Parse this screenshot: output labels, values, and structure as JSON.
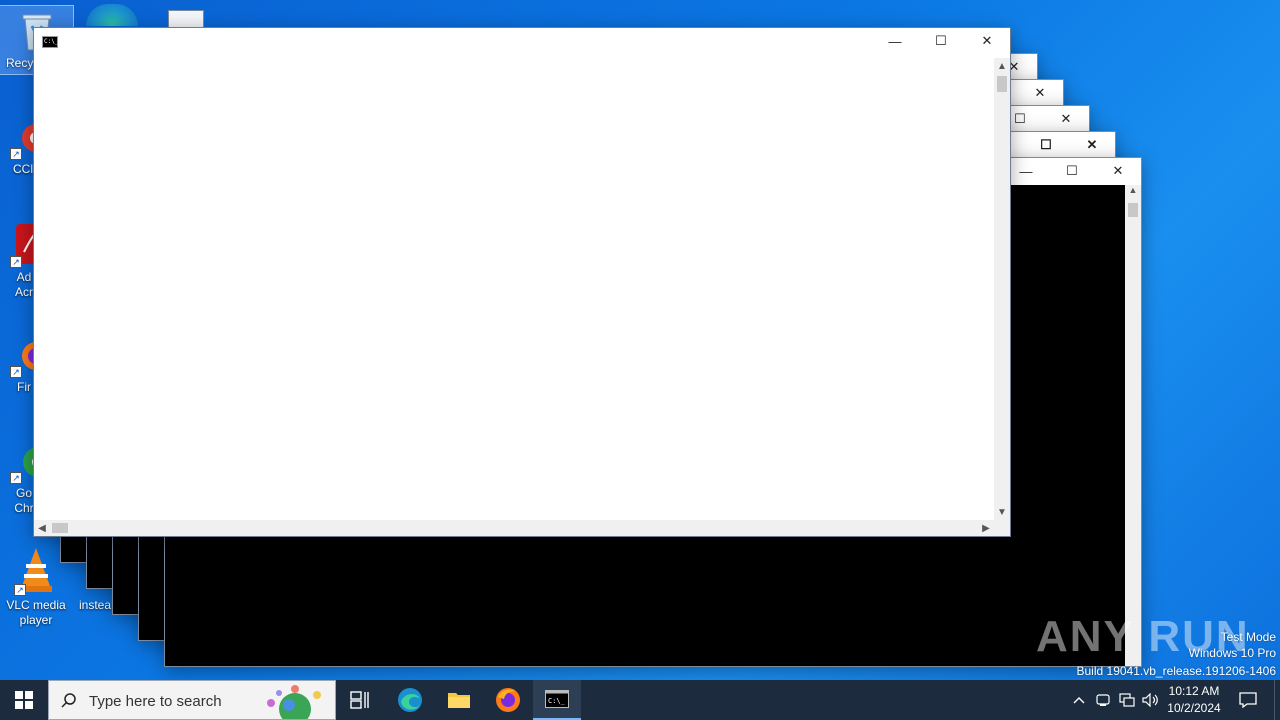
{
  "desktop_icons": [
    {
      "label": "Recy",
      "icon": "recycle-bin-icon"
    },
    {
      "label": "CCl",
      "icon": "ccleaner-icon"
    },
    {
      "label": "Ad Acr",
      "icon": "acrobat-icon"
    },
    {
      "label": "Fir",
      "icon": "firefox-icon"
    },
    {
      "label": "Go Chr",
      "icon": "chrome-icon"
    },
    {
      "label": "VLC media player",
      "icon": "vlc-icon"
    },
    {
      "label": "instea",
      "icon": "file-icon"
    }
  ],
  "main_window": {
    "minimize": "—",
    "maximize": "☐",
    "close": "✕"
  },
  "taskbar": {
    "search_placeholder": "Type here to search",
    "apps": [
      "task-view",
      "edge",
      "file-explorer",
      "firefox",
      "cmd"
    ]
  },
  "clock": {
    "time": "10:12 AM",
    "date": "10/2/2024"
  },
  "watermark": {
    "line1": "Test Mode",
    "line2": "Windows 10 Pro",
    "line3": "Build 19041.vb_release.191206-1406",
    "brand": "ANY RUN"
  },
  "colors": {
    "desktop": "#0b78e3",
    "taskbar": "#1c2b3d"
  }
}
